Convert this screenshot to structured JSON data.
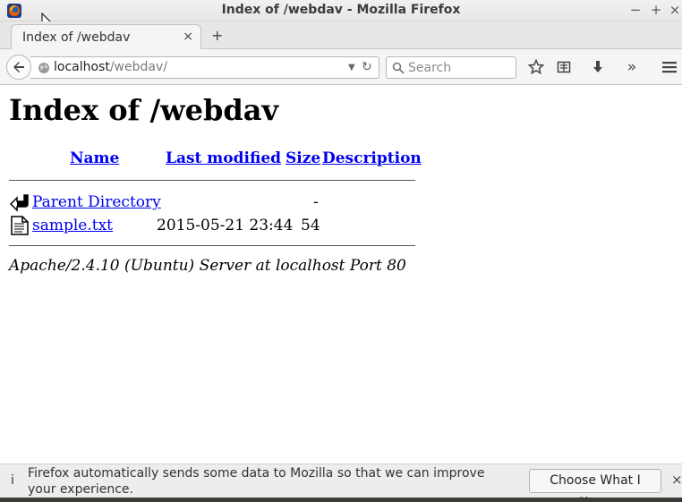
{
  "window": {
    "title": "Index of /webdav - Mozilla Firefox",
    "minimize": "−",
    "maximize": "+",
    "close": "×"
  },
  "tab": {
    "label": "Index of /webdav",
    "close": "×",
    "new_tab": "+"
  },
  "urlbar": {
    "host": "localhost",
    "path": "/webdav/",
    "dropdown": "▼",
    "reload": "↻"
  },
  "search": {
    "placeholder": "Search"
  },
  "toolbar": {
    "icons": [
      "star-icon",
      "reading-list-icon",
      "downloads-icon",
      "overflow-icon",
      "menu-icon"
    ],
    "overflow": "»"
  },
  "page": {
    "title": "Index of /webdav",
    "headers": {
      "name": "Name",
      "modified": "Last modified",
      "size": "Size",
      "description": "Description"
    },
    "rows": [
      {
        "icon": "back-icon",
        "name": "Parent Directory",
        "modified": "",
        "size": "-",
        "description": ""
      },
      {
        "icon": "text-file-icon",
        "name": "sample.txt",
        "modified": "2015-05-21 23:44",
        "size": "54",
        "description": ""
      }
    ],
    "server_signature": "Apache/2.4.10 (Ubuntu) Server at localhost Port 80"
  },
  "notification": {
    "icon": "i",
    "text": "Firefox automatically sends some data to Mozilla so that we can improve your experience.",
    "button": "Choose What I Share",
    "close": "×"
  },
  "colors": {
    "link": "#0000ee",
    "chrome_bg": "#e8e7e5",
    "title_text": "#3c3c3c"
  }
}
